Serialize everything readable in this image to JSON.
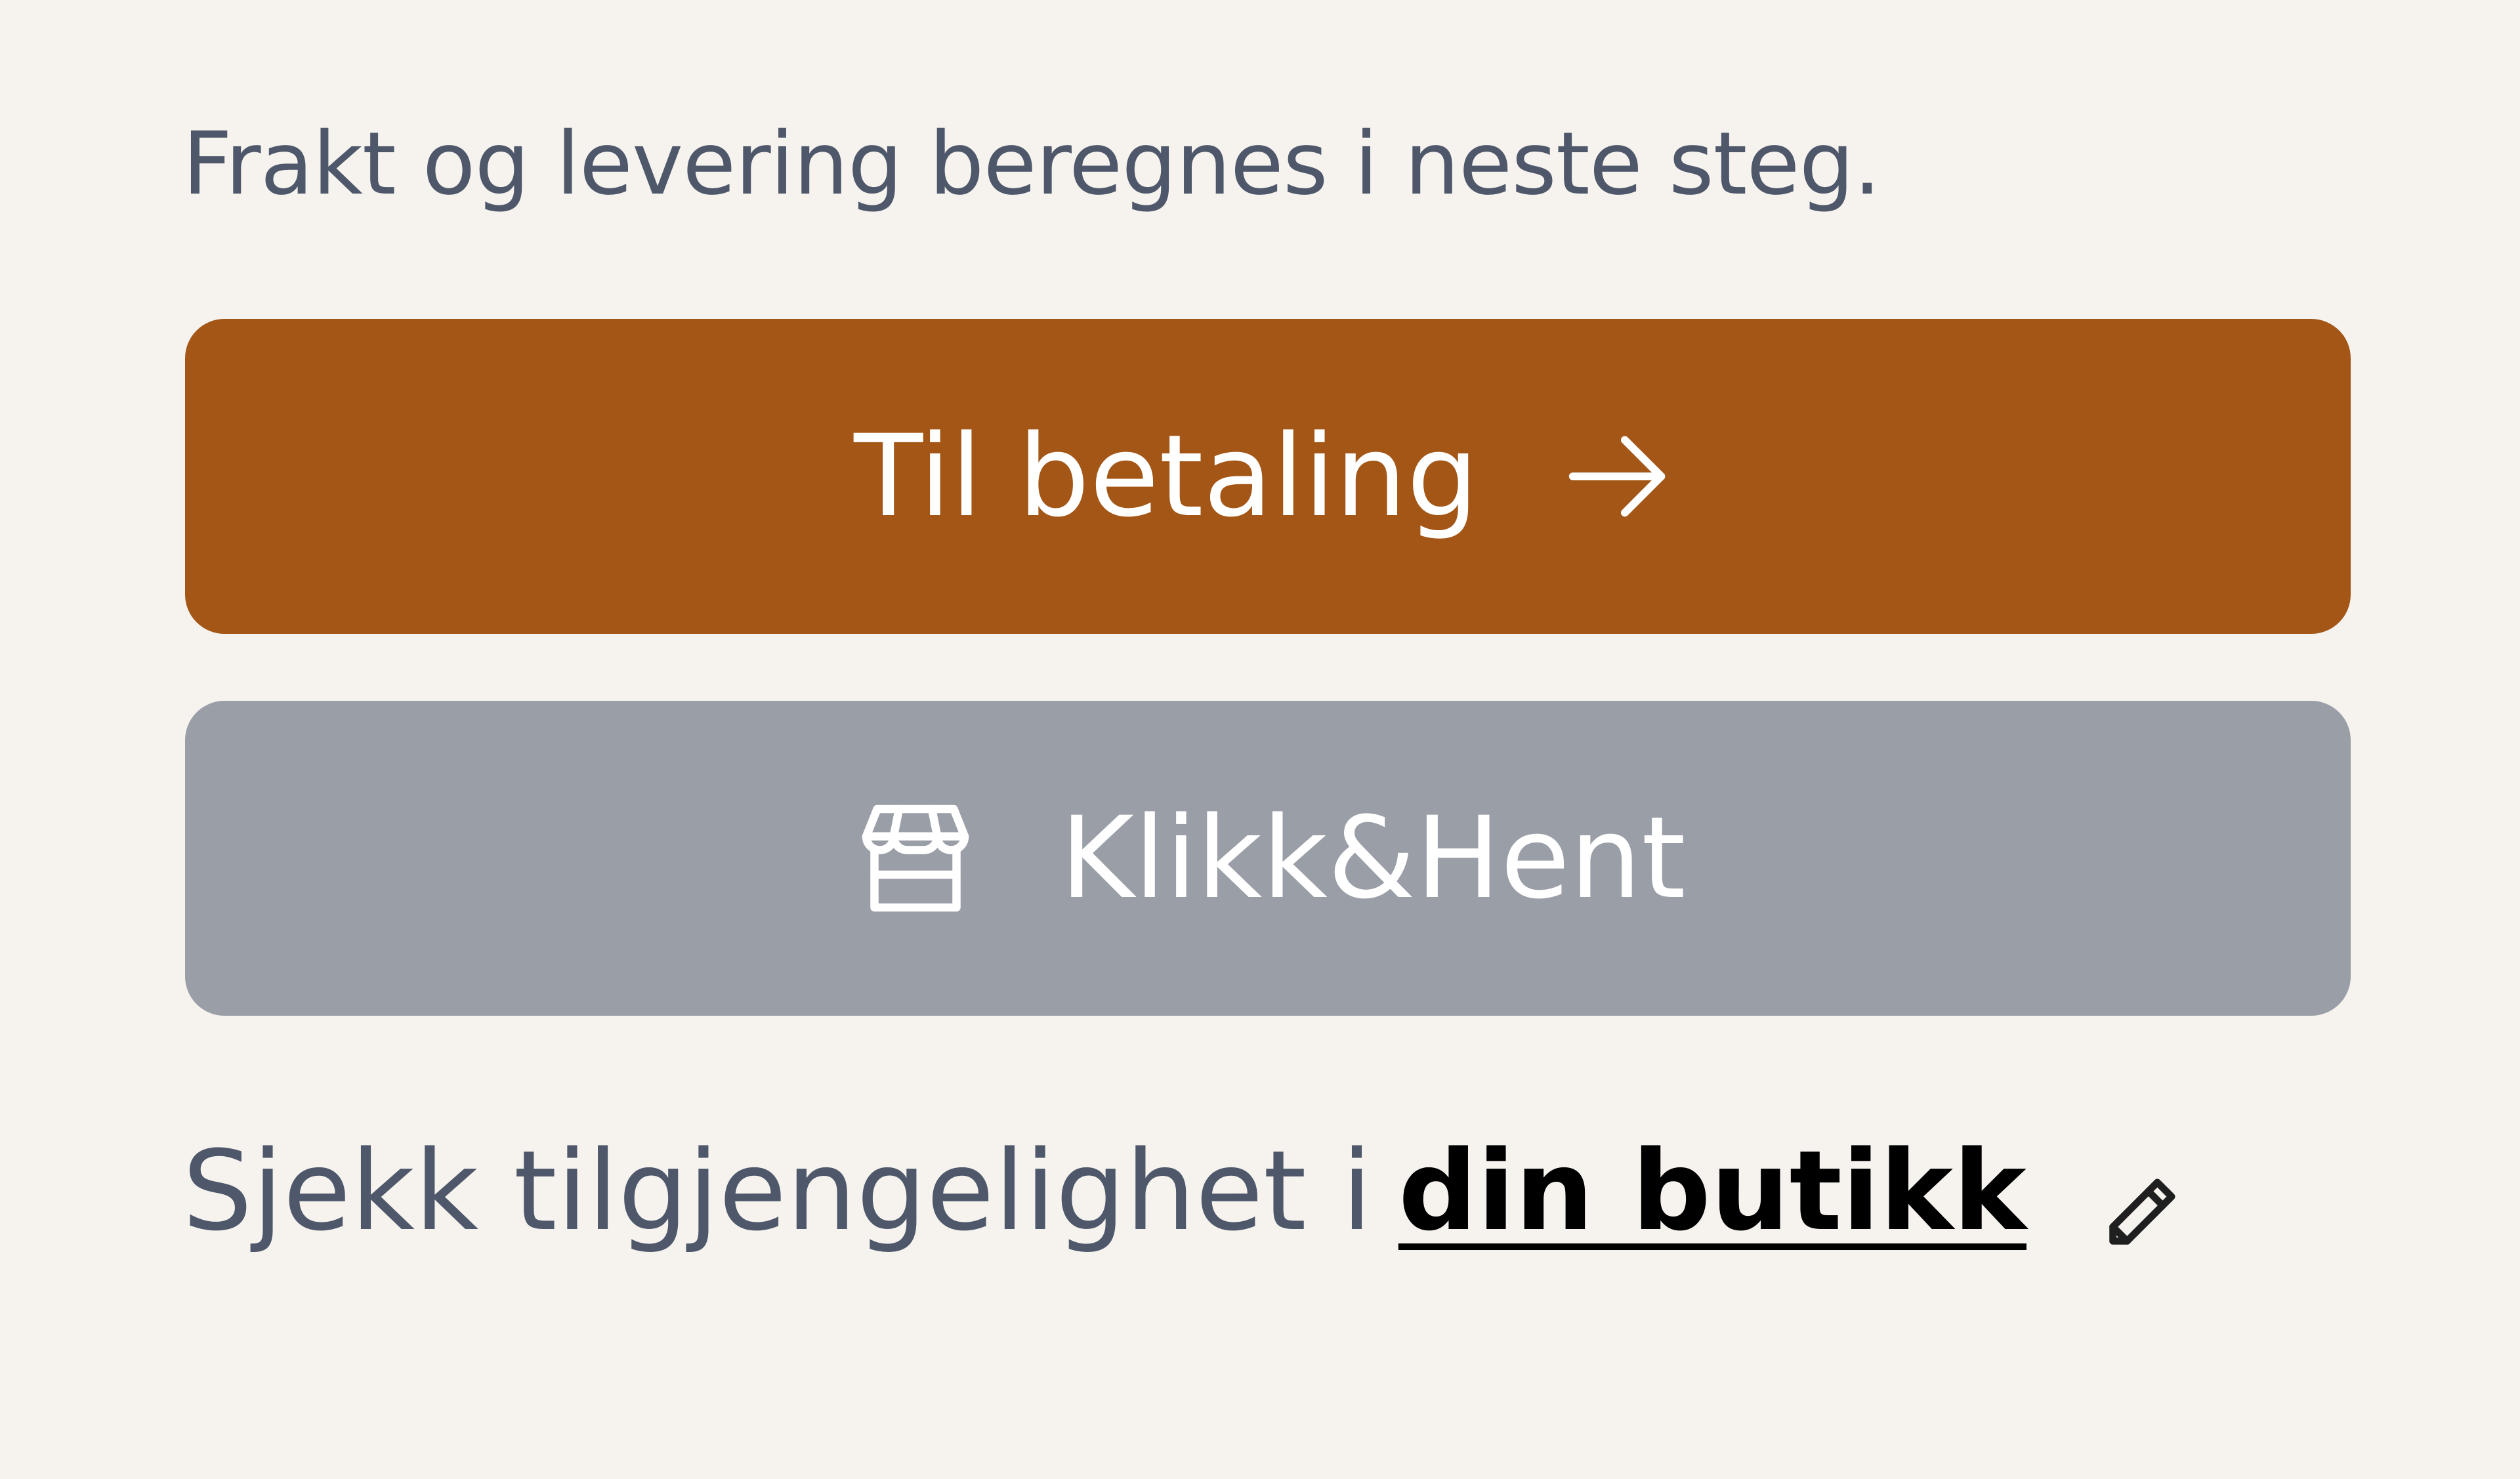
{
  "shipping_note": "Frakt og levering beregnes i neste steg.",
  "checkout_button": {
    "label": "Til betaling",
    "icon": "arrow-right-icon",
    "color": "#a35616"
  },
  "pickup_button": {
    "label": "Klikk&Hent",
    "icon": "store-icon",
    "color": "#9a9ea7"
  },
  "availability": {
    "prefix": "Sjekk tilgjengelighet i",
    "store_link": "din butikk",
    "edit_icon": "pencil-icon"
  }
}
